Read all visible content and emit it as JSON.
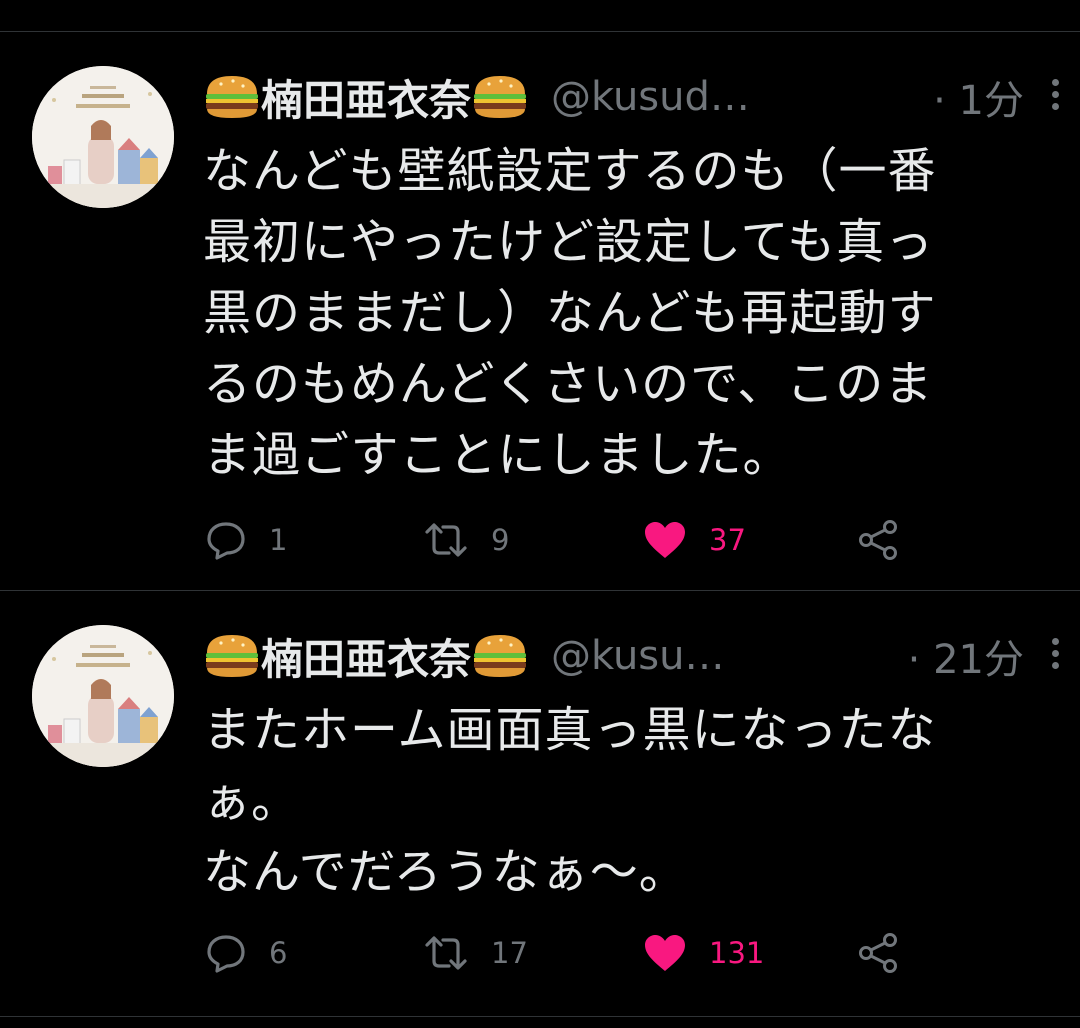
{
  "colors": {
    "background": "#000000",
    "text_primary": "#e7e9ea",
    "text_secondary": "#71767b",
    "like_active": "#f91880",
    "divider": "#2f3336"
  },
  "tweets": [
    {
      "display_name": "楠田亜衣奈",
      "name_emoji": "hamburger-emoji",
      "handle": "@kusud…",
      "time": "· 1分",
      "text_lines": [
        "なんども壁紙設定するのも（一番",
        "最初にやったけど設定しても真っ",
        "黒のままだし）なんども再起動す",
        "るのもめんどくさいので、このま",
        "ま過ごすことにしました。"
      ],
      "reply_count": "1",
      "retweet_count": "9",
      "like_count": "37",
      "liked": true
    },
    {
      "display_name": "楠田亜衣奈",
      "name_emoji": "hamburger-emoji",
      "handle": "@kusu…",
      "time": "· 21分",
      "text_lines": [
        "またホーム画面真っ黒になったな",
        "ぁ。",
        "なんでだろうなぁ〜。"
      ],
      "reply_count": "6",
      "retweet_count": "17",
      "like_count": "131",
      "liked": true
    }
  ]
}
